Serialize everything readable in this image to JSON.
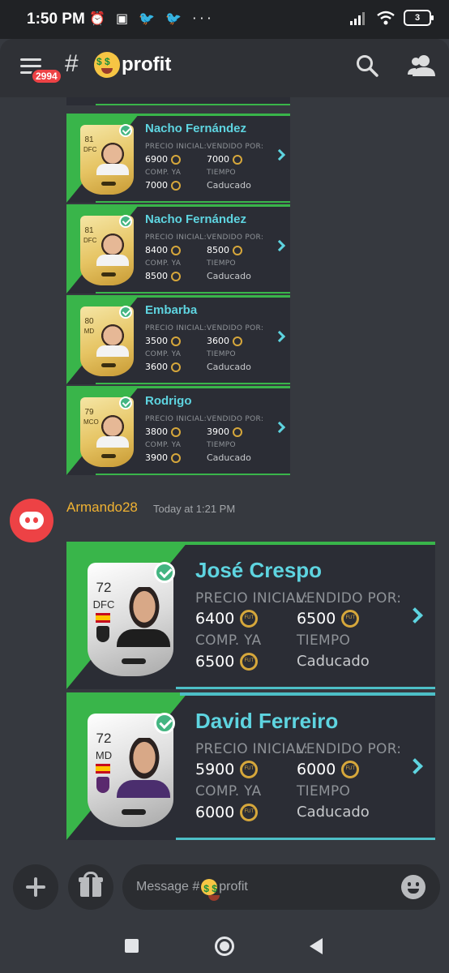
{
  "status_bar": {
    "time": "1:50 PM",
    "battery": "3"
  },
  "header": {
    "badge": "2994",
    "hash": "#",
    "channel": "profit",
    "channel_emoji": "money-mouth-face"
  },
  "colors": {
    "accent_cyan": "#5ed4e0",
    "green": "#39b54a",
    "username": "#f0b232",
    "badge_red": "#ed4245"
  },
  "old_listings": [
    {
      "name": "Nacho Fernández",
      "rating": "81",
      "position": "DFC",
      "precio_inicial_label": "PRECIO INICIAL:",
      "precio_inicial": "6900",
      "vendido_por_label": "VENDIDO POR:",
      "vendido_por": "7000",
      "comp_ya_label": "COMP. YA",
      "comp_ya": "7000",
      "tiempo_label": "TIEMPO",
      "tiempo": "Caducado"
    },
    {
      "name": "Nacho Fernández",
      "rating": "81",
      "position": "DFC",
      "precio_inicial_label": "PRECIO INICIAL:",
      "precio_inicial": "8400",
      "vendido_por_label": "VENDIDO POR:",
      "vendido_por": "8500",
      "comp_ya_label": "COMP. YA",
      "comp_ya": "8500",
      "tiempo_label": "TIEMPO",
      "tiempo": "Caducado"
    },
    {
      "name": "Embarba",
      "rating": "80",
      "position": "MD",
      "precio_inicial_label": "PRECIO INICIAL:",
      "precio_inicial": "3500",
      "vendido_por_label": "VENDIDO POR:",
      "vendido_por": "3600",
      "comp_ya_label": "COMP. YA",
      "comp_ya": "3600",
      "tiempo_label": "TIEMPO",
      "tiempo": "Caducado"
    },
    {
      "name": "Rodrigo",
      "rating": "79",
      "position": "MCO",
      "precio_inicial_label": "PRECIO INICIAL:",
      "precio_inicial": "3800",
      "vendido_por_label": "VENDIDO POR:",
      "vendido_por": "3900",
      "comp_ya_label": "COMP. YA",
      "comp_ya": "3900",
      "tiempo_label": "TIEMPO",
      "tiempo": "Caducado"
    }
  ],
  "message": {
    "author": "Armando28",
    "timestamp": "Today at 1:21 PM"
  },
  "new_listings": [
    {
      "name": "José Crespo",
      "rating": "72",
      "position": "DFC",
      "precio_inicial_label": "PRECIO INICIAL:",
      "precio_inicial": "6400",
      "vendido_por_label": "VENDIDO POR:",
      "vendido_por": "6500",
      "comp_ya_label": "COMP. YA",
      "comp_ya": "6500",
      "tiempo_label": "TIEMPO",
      "tiempo": "Caducado"
    },
    {
      "name": "David Ferreiro",
      "rating": "72",
      "position": "MD",
      "precio_inicial_label": "PRECIO INICIAL:",
      "precio_inicial": "5900",
      "vendido_por_label": "VENDIDO POR:",
      "vendido_por": "6000",
      "comp_ya_label": "COMP. YA",
      "comp_ya": "6000",
      "tiempo_label": "TIEMPO",
      "tiempo": "Caducado"
    }
  ],
  "composer": {
    "placeholder_prefix": "Message #",
    "placeholder_channel": "profit"
  }
}
